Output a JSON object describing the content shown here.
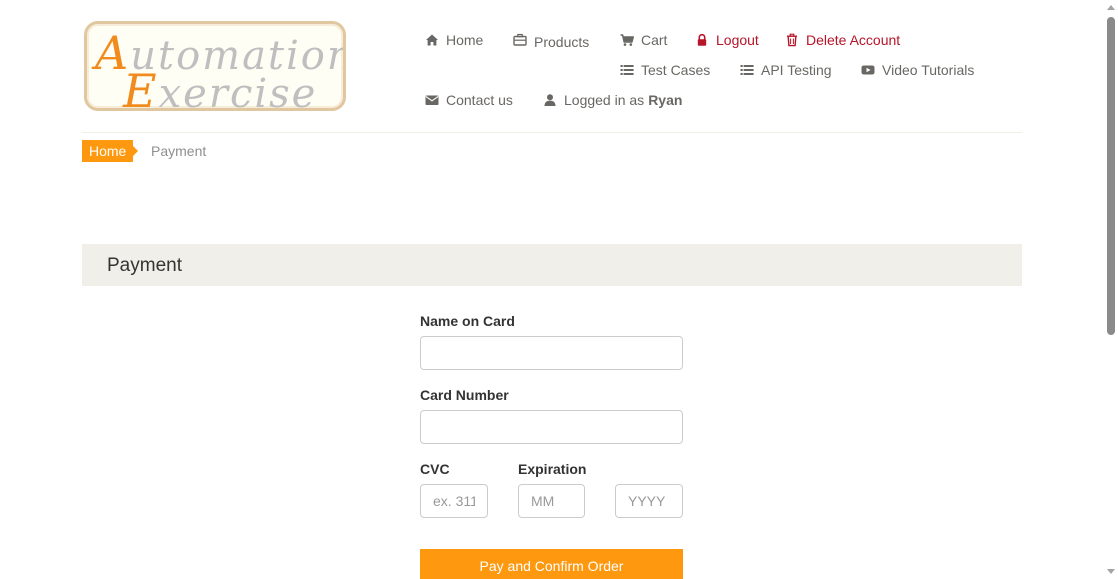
{
  "logo": {
    "line1_cap": "A",
    "line1_rest": "utomation",
    "line2_cap": "E",
    "line2_rest": "xercise"
  },
  "nav": {
    "home": "Home",
    "products": "Products",
    "cart": "Cart",
    "logout": "Logout",
    "delete_account": "Delete Account",
    "test_cases": "Test Cases",
    "api_testing": "API Testing",
    "video_tutorials": "Video Tutorials",
    "contact_us": "Contact us",
    "logged_in_prefix": "Logged in as",
    "logged_in_user": "Ryan"
  },
  "breadcrumb": {
    "home": "Home",
    "current": "Payment"
  },
  "payment": {
    "heading": "Payment",
    "name_label": "Name on Card",
    "name_value": "",
    "card_number_label": "Card Number",
    "card_number_value": "",
    "cvc_label": "CVC",
    "cvc_placeholder": "ex. 311",
    "expiration_label": "Expiration",
    "month_placeholder": "MM",
    "year_placeholder": "YYYY",
    "submit_label": "Pay and Confirm Order"
  },
  "colors": {
    "accent": "#fe980f",
    "danger": "#b6152a",
    "heading_bg": "#f0efe9"
  }
}
